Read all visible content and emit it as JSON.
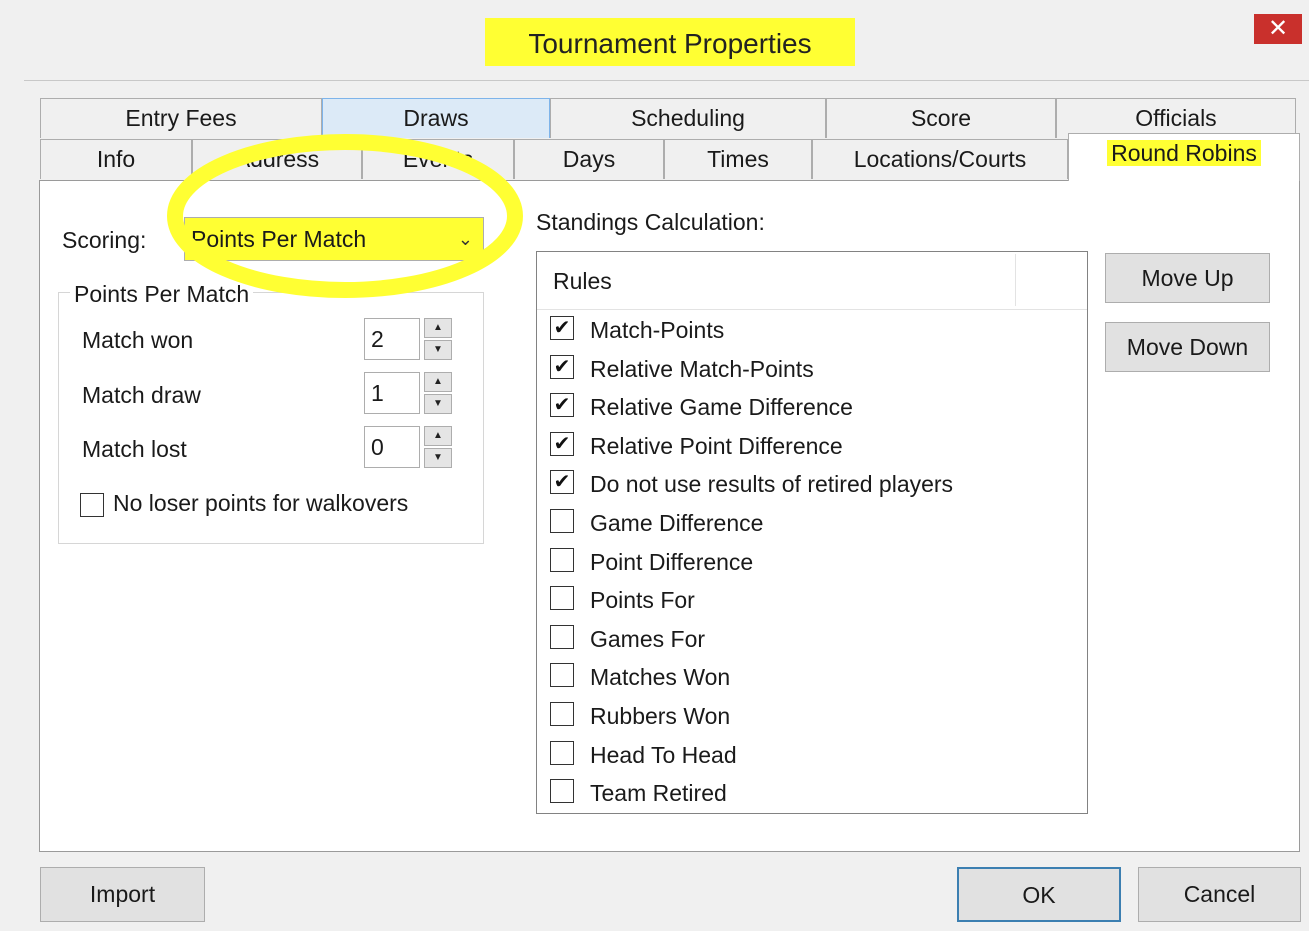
{
  "window": {
    "title": "Tournament Properties",
    "close_glyph": "✕",
    "accent_color": "#c9302c",
    "highlight_color": "#ffff33"
  },
  "tabs": {
    "row1": [
      "Entry Fees",
      "Draws",
      "Scheduling",
      "Score",
      "Officials"
    ],
    "row2": [
      "Info",
      "Address",
      "Events",
      "Days",
      "Times",
      "Locations/Courts",
      "Round Robins"
    ],
    "active": "Round Robins"
  },
  "scoring": {
    "label": "Scoring:",
    "selected": "Points Per Match",
    "chevron": "chevron-down-icon"
  },
  "points_per_match": {
    "legend": "Points Per Match",
    "rows": [
      {
        "label": "Match won",
        "value": "2"
      },
      {
        "label": "Match draw",
        "value": "1"
      },
      {
        "label": "Match lost",
        "value": "0"
      }
    ],
    "walkover_label": "No loser points for walkovers",
    "walkover_checked": false
  },
  "standings": {
    "label": "Standings Calculation:",
    "header": "Rules",
    "rules": [
      {
        "label": "Match-Points",
        "checked": true
      },
      {
        "label": "Relative Match-Points",
        "checked": true
      },
      {
        "label": "Relative Game Difference",
        "checked": true
      },
      {
        "label": "Relative Point Difference",
        "checked": true
      },
      {
        "label": "Do not use results of retired players",
        "checked": true
      },
      {
        "label": "Game Difference",
        "checked": false
      },
      {
        "label": "Point Difference",
        "checked": false
      },
      {
        "label": "Points For",
        "checked": false
      },
      {
        "label": "Games For",
        "checked": false
      },
      {
        "label": "Matches Won",
        "checked": false
      },
      {
        "label": "Rubbers Won",
        "checked": false
      },
      {
        "label": "Head To Head",
        "checked": false
      },
      {
        "label": "Team Retired",
        "checked": false
      }
    ]
  },
  "buttons": {
    "move_up": "Move Up",
    "move_down": "Move Down",
    "import": "Import",
    "ok": "OK",
    "cancel": "Cancel"
  }
}
